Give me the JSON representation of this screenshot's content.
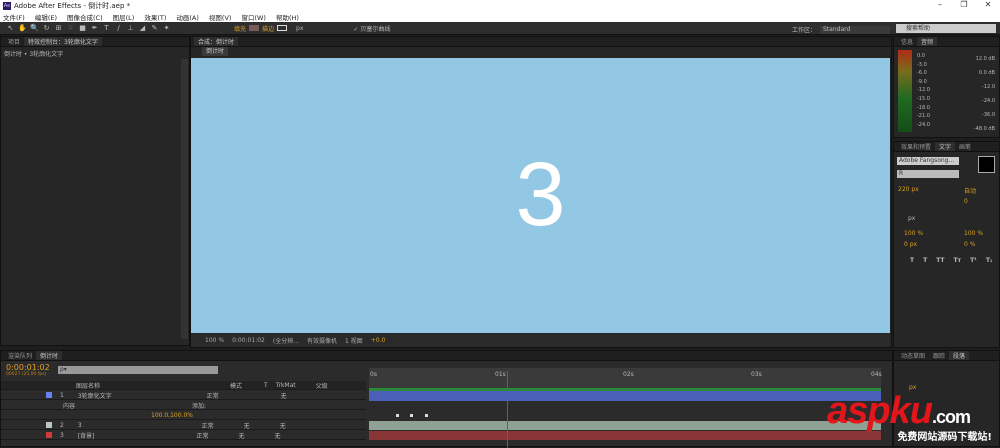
{
  "titlebar": {
    "app_icon": "Ae",
    "title": "Adobe After Effects - 倒计时.aep *"
  },
  "menu": [
    "文件(F)",
    "编辑(E)",
    "图像合成(C)",
    "图层(L)",
    "效果(T)",
    "动画(A)",
    "视图(V)",
    "窗口(W)",
    "帮助(H)"
  ],
  "toolbar": {
    "fill_label": "填充",
    "stroke_label": "描边",
    "stroke_px": "px",
    "bezier_label": "✓ 贝塞尔曲线",
    "workspace_label": "工作区：",
    "workspace_value": "Standard",
    "search_placeholder": "搜索帮助"
  },
  "left_panel": {
    "tabs": [
      "项目",
      "特效控制台：3轮廓化文字"
    ],
    "breadcrumb": "倒计时 • 3轮廓化文字"
  },
  "comp_panel": {
    "tab": "合成：倒计时",
    "subtab": "倒计时",
    "content": "3",
    "bg_color": "#92c8e3",
    "controls": {
      "zoom": "100 %",
      "timecode": "0:00:01:02",
      "resolution": "(全分辨...",
      "camera": "有效摄像机",
      "views": "1 视图",
      "exposure": "+0.0"
    }
  },
  "audio_panel": {
    "tabs": [
      "信息",
      "音频"
    ],
    "left_scale": [
      "0.0",
      "-3.0",
      "-6.0",
      "-9.0",
      "-12.0",
      "-15.0",
      "-18.0",
      "-21.0",
      "-24.0"
    ],
    "right_scale": [
      "12.0 dB",
      "0.0 dB",
      "-12.0",
      "-24.0",
      "-36.0",
      "-48.0 dB"
    ]
  },
  "char_panel": {
    "tabs": [
      "效果和预置",
      "文字",
      "画笔"
    ],
    "font": "Adobe Fangsong...",
    "style": "R",
    "size": "220 px",
    "leading": "自动",
    "tracking": "0",
    "kern_unit": "px",
    "vscale": "100 %",
    "hscale": "100 %",
    "baseline": "0 px",
    "tsume": "0 %",
    "styles": [
      "T",
      "T",
      "TT",
      "Tт",
      "T¹",
      "T₁"
    ]
  },
  "timeline": {
    "tabs": [
      "渲染队列",
      "倒计时"
    ],
    "timecode": "0:00:01:02",
    "frames": "00027 (25.00 fps)",
    "search_placeholder": "ρ▾",
    "headers": [
      "图层名称",
      "模式",
      "T",
      "TrkMat",
      "父级"
    ],
    "layers": [
      {
        "num": "1",
        "name": "3轮廓化文字",
        "color": "#6a7ff0",
        "mode": "正常",
        "trkmat": "",
        "parent": "无"
      },
      {
        "num": "2",
        "name": "3",
        "color": "#b8c8c0",
        "mode": "正常",
        "trkmat": "无",
        "parent": "无"
      },
      {
        "num": "3",
        "name": "[背景]",
        "color": "#d03a3a",
        "mode": "正常",
        "trkmat": "无",
        "parent": "无"
      }
    ],
    "content_label": "内容",
    "add_label": "添加:",
    "scale_value": "100.0,100.0%",
    "ruler": [
      "0s",
      "01s",
      "02s",
      "03s",
      "04s"
    ]
  },
  "bottom_right": {
    "tabs": [
      "动态草图",
      "跟踪",
      "段落"
    ],
    "px": "px"
  },
  "watermark": {
    "brand": "aspku",
    "tld": ".com",
    "slogan": "免费网站源码下载站!"
  }
}
